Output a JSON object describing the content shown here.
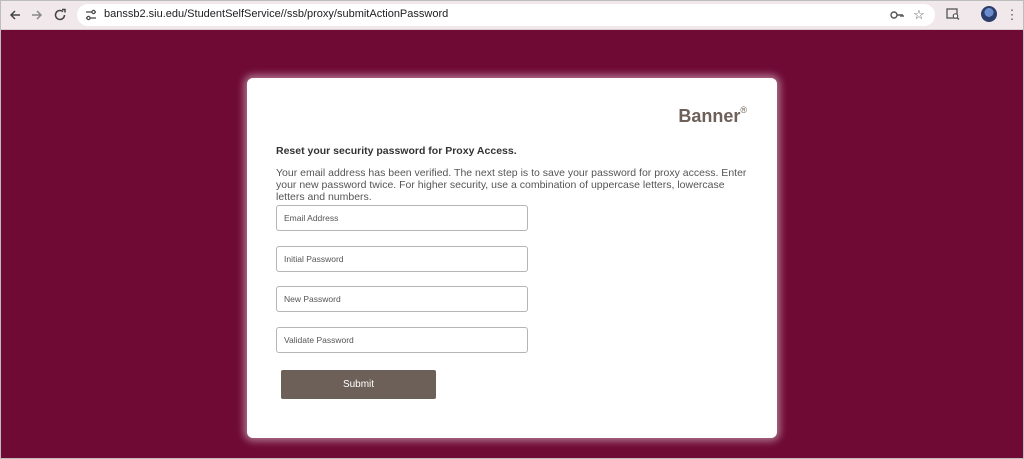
{
  "browser": {
    "url": "banssb2.siu.edu/StudentSelfService//ssb/proxy/submitActionPassword"
  },
  "card": {
    "brand": "Banner",
    "brand_mark": "®",
    "heading": "Reset your security password for Proxy Access.",
    "description": "Your email address has been verified. The next step is to save your password for proxy access. Enter your new password twice. For higher security, use a combination of uppercase letters, lowercase letters and numbers."
  },
  "form": {
    "email_placeholder": "Email Address",
    "initial_password_placeholder": "Initial Password",
    "new_password_placeholder": "New Password",
    "validate_password_placeholder": "Validate Password",
    "submit_label": "Submit"
  },
  "colors": {
    "page_background": "#6f0a35",
    "button": "#6d6058",
    "toolbar": "#f1e8eb"
  },
  "icons": {
    "back": "back-arrow-icon",
    "forward": "forward-arrow-icon",
    "reload": "reload-icon",
    "site_info": "tune-icon",
    "password_key": "key-icon",
    "bookmark": "star-icon",
    "tab_search": "tab-search-icon",
    "profile": "avatar",
    "menu": "kebab-menu-icon"
  }
}
